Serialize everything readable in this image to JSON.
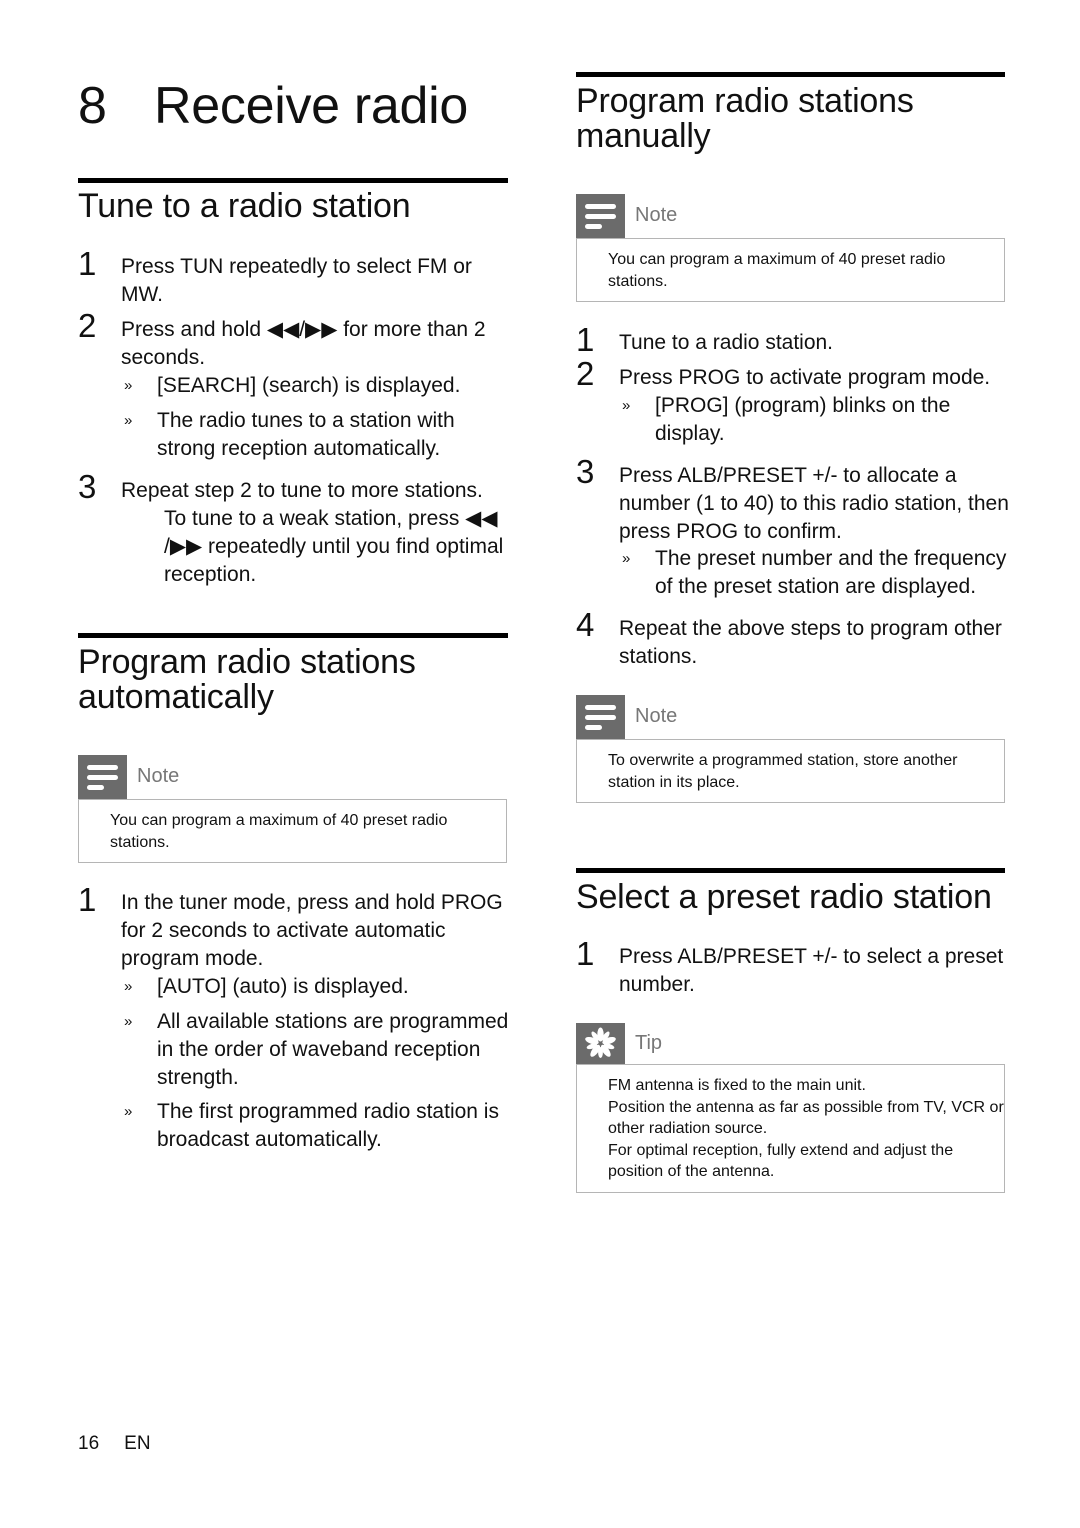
{
  "chapter": {
    "number": "8",
    "title": "Receive radio"
  },
  "left": {
    "tune": {
      "title": "Tune to a radio station",
      "steps": [
        {
          "num": "1",
          "lines": [
            "Press TUN repeatedly to select FM or",
            "MW."
          ]
        },
        {
          "num": "2",
          "lines": [
            "Press and hold ◀◀/▶▶ for more than 2",
            "seconds."
          ],
          "results": [
            {
              "bullet": "»",
              "lines": [
                "[SEARCH] (search) is displayed."
              ]
            },
            {
              "bullet": "»",
              "lines": [
                "The radio tunes to a station with",
                "strong reception automatically."
              ]
            }
          ]
        },
        {
          "num": "3",
          "lines": [
            "Repeat step 2 to tune to more stations."
          ],
          "extra": [
            "To tune to a weak station, press ◀◀",
            "/▶▶ repeatedly until you find optimal",
            "reception."
          ]
        }
      ]
    },
    "auto": {
      "title_lines": [
        "Program radio stations",
        "automatically"
      ],
      "note": {
        "label": "Note",
        "icon": "note-icon",
        "lines": [
          "You can program a maximum of 40 preset radio",
          "stations."
        ]
      },
      "steps": [
        {
          "num": "1",
          "lines": [
            "In the tuner mode, press and hold PROG",
            "for 2 seconds to activate automatic",
            "program mode."
          ],
          "results": [
            {
              "bullet": "»",
              "lines": [
                "[AUTO] (auto) is displayed."
              ]
            },
            {
              "bullet": "»",
              "lines": [
                "All available stations are programmed",
                "in the order of waveband reception",
                "strength."
              ]
            },
            {
              "bullet": "»",
              "lines": [
                "The first programmed radio station is",
                "broadcast automatically."
              ]
            }
          ]
        }
      ]
    }
  },
  "right": {
    "manual": {
      "title_lines": [
        "Program radio stations",
        "manually"
      ],
      "note": {
        "label": "Note",
        "icon": "note-icon",
        "lines": [
          "You can program a maximum of 40 preset radio",
          "stations."
        ]
      },
      "steps": [
        {
          "num": "1",
          "lines": [
            "Tune to a radio station."
          ]
        },
        {
          "num": "2",
          "lines": [
            "Press PROG to activate program mode."
          ],
          "results": [
            {
              "bullet": "»",
              "lines": [
                "[PROG] (program) blinks on the",
                "display."
              ]
            }
          ]
        },
        {
          "num": "3",
          "lines": [
            "Press ALB/PRESET +/- to allocate a",
            "number (1 to 40) to this radio station, then",
            "press PROG to confirm."
          ],
          "results": [
            {
              "bullet": "»",
              "lines": [
                "The preset number and the frequency",
                "of the preset station are displayed."
              ]
            }
          ]
        },
        {
          "num": "4",
          "lines": [
            "Repeat the above steps to program other",
            "stations."
          ]
        }
      ],
      "note2": {
        "label": "Note",
        "icon": "note-icon",
        "lines": [
          "To overwrite a programmed station, store another",
          "station in its place."
        ]
      }
    },
    "preset": {
      "title": "Select a preset radio station",
      "steps": [
        {
          "num": "1",
          "lines": [
            "Press ALB/PRESET +/- to select a preset",
            "number."
          ]
        }
      ],
      "tip": {
        "label": "Tip",
        "icon": "tip-asterisk-icon",
        "lines": [
          "FM antenna is fixed to the main unit.",
          "Position the antenna as far as possible from TV, VCR or",
          "other radiation source.",
          "For optimal reception, fully extend and adjust the",
          "position of the antenna."
        ]
      }
    }
  },
  "footer": {
    "page": "16",
    "lang": "EN"
  }
}
